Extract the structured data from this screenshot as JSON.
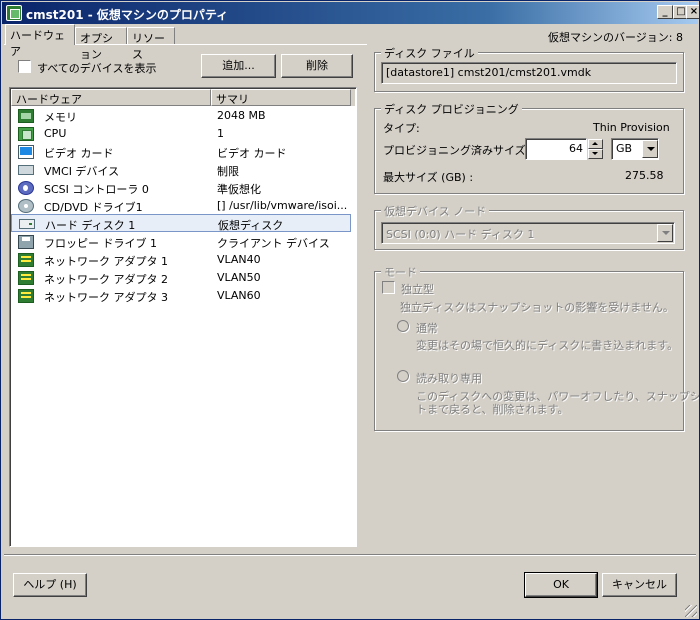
{
  "window": {
    "title": "cmst201 - 仮想マシンのプロパティ",
    "version_label": "仮想マシンのバージョン: 8"
  },
  "title_buttons": {
    "minimize": "_",
    "maximize": "□",
    "close": "×"
  },
  "tabs": [
    {
      "label": "ハードウェア",
      "active": true
    },
    {
      "label": "オプション",
      "active": false
    },
    {
      "label": "リソース",
      "active": false
    }
  ],
  "hardware": {
    "show_all_label": "すべてのデバイスを表示",
    "add_button": "追加...",
    "remove_button": "削除",
    "columns": [
      "ハードウェア",
      "サマリ"
    ],
    "rows": [
      {
        "icon": "memory-icon",
        "name": "メモリ",
        "summary": "2048 MB"
      },
      {
        "icon": "cpu-icon",
        "name": "CPU",
        "summary": "1"
      },
      {
        "icon": "video-card-icon",
        "name": "ビデオ カード",
        "summary": "ビデオ カード"
      },
      {
        "icon": "vmci-device-icon",
        "name": "VMCI デバイス",
        "summary": "制限"
      },
      {
        "icon": "scsi-controller-icon",
        "name": "SCSI コントローラ 0",
        "summary": "準仮想化"
      },
      {
        "icon": "cd-dvd-icon",
        "name": "CD/DVD ドライブ1",
        "summary": "[] /usr/lib/vmware/isoi..."
      },
      {
        "icon": "hard-disk-icon",
        "name": "ハード ディスク 1",
        "summary": "仮想ディスク",
        "selected": true
      },
      {
        "icon": "floppy-drive-icon",
        "name": "フロッピー ドライブ 1",
        "summary": "クライアント デバイス"
      },
      {
        "icon": "network-adapter-icon",
        "name": "ネットワーク アダプタ 1",
        "summary": "VLAN40"
      },
      {
        "icon": "network-adapter-icon",
        "name": "ネットワーク アダプタ 2",
        "summary": "VLAN50"
      },
      {
        "icon": "network-adapter-icon",
        "name": "ネットワーク アダプタ 3",
        "summary": "VLAN60"
      }
    ]
  },
  "disk_file": {
    "title": "ディスク ファイル",
    "value": "[datastore1] cmst201/cmst201.vmdk"
  },
  "provisioning": {
    "title": "ディスク プロビジョニング",
    "type_label": "タイプ:",
    "type_value": "Thin Provision",
    "size_label": "プロビジョニング済みサイズ:",
    "size_value": "64",
    "size_unit": "GB",
    "max_label": "最大サイズ (GB) :",
    "max_value": "275.58"
  },
  "virtual_device_node": {
    "title": "仮想デバイス ノード",
    "value": "SCSI (0:0) ハード ディスク 1"
  },
  "mode": {
    "title": "モード",
    "independent_label": "独立型",
    "independent_desc": "独立ディスクはスナップショットの影響を受けません。",
    "normal_label": "通常",
    "normal_desc": "変更はその場で恒久的にディスクに書き込まれます。",
    "readonly_label": "読み取り専用",
    "readonly_desc_1": "このディスクへの変更は、パワーオフしたり、スナップショッ",
    "readonly_desc_2": "トまで戻ると、削除されます。"
  },
  "footer": {
    "help_button": "ヘルプ (H)",
    "ok_button": "OK",
    "cancel_button": "キャンセル"
  }
}
